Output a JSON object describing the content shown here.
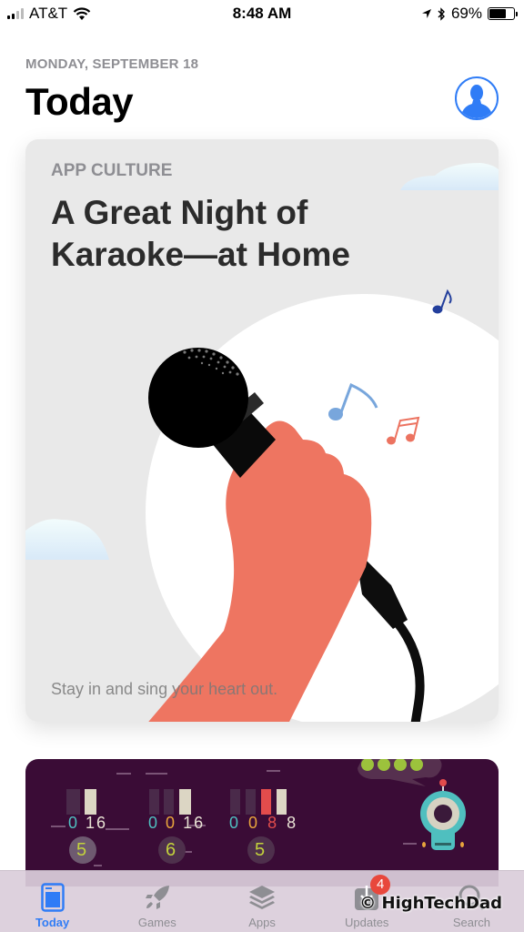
{
  "status_bar": {
    "carrier": "AT&T",
    "time": "8:48 AM",
    "battery_percent": "69%",
    "battery_level": 0.69,
    "icons": [
      "signal-icon",
      "wifi-icon",
      "location-icon",
      "bluetooth-icon",
      "battery-icon"
    ]
  },
  "header": {
    "date": "MONDAY, SEPTEMBER 18",
    "title": "Today",
    "account_icon": "person-circle-icon"
  },
  "featured_card": {
    "eyebrow": "APP CULTURE",
    "title": "A Great Night of Karaoke—at Home",
    "caption": "Stay in and sing your heart out.",
    "illustration": "hand-holding-microphone"
  },
  "second_card": {
    "score_groups": [
      {
        "digits": [
          "0",
          "16"
        ],
        "digit_colors": [
          "#4fbfbf",
          "#e8e2d4"
        ],
        "circle": "5"
      },
      {
        "digits": [
          "0",
          "0",
          "16"
        ],
        "digit_colors": [
          "#4fbfbf",
          "#e8a53c",
          "#e8e2d4"
        ],
        "circle": "6"
      },
      {
        "digits": [
          "0",
          "0",
          "8",
          "8"
        ],
        "digit_colors": [
          "#4fbfbf",
          "#e8a53c",
          "#e24c4c",
          "#e8e2d4"
        ],
        "circle": "5"
      }
    ],
    "illustration": "robot-character"
  },
  "tab_bar": {
    "tabs": [
      {
        "label": "Today",
        "icon": "today-icon",
        "active": true
      },
      {
        "label": "Games",
        "icon": "rocket-icon",
        "active": false
      },
      {
        "label": "Apps",
        "icon": "layers-icon",
        "active": false
      },
      {
        "label": "Updates",
        "icon": "download-icon",
        "active": false,
        "badge": "4"
      },
      {
        "label": "Search",
        "icon": "search-icon",
        "active": false
      }
    ]
  },
  "watermark": "© HighTechDad",
  "colors": {
    "accent": "#2f7cf6",
    "badge": "#e8473c",
    "hand": "#ee7561",
    "card_bg": "#e9e9e9",
    "card2_bg": "#3a0c36"
  }
}
